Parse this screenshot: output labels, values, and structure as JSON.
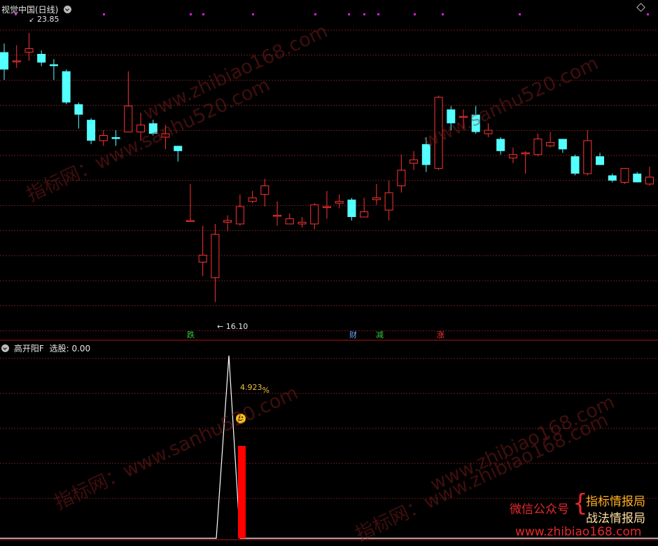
{
  "top_panel": {
    "title": "视觉中国(日线)",
    "high_label": "23.85",
    "low_label": "16.10",
    "arrow": "←"
  },
  "badges": [
    {
      "text": "跌",
      "color": "#33cc33"
    },
    {
      "text": "财",
      "color": "#66aaff"
    },
    {
      "text": "减",
      "color": "#33cc33"
    },
    {
      "text": "涨",
      "color": "#ff3333"
    }
  ],
  "bottom_panel": {
    "title": "高开阳F",
    "select_label": "选股:",
    "select_value": "0.00",
    "percent_value": "4.923",
    "percent_sign": "%"
  },
  "watermarks": [
    "指标网：www.sanhu520.com",
    "www.zhibiao168.com",
    "www.sanhu520.com",
    "www.zhibiao168.com",
    "指标网：www.sanhu520.com",
    "指标网：www.zhibiao168.com"
  ],
  "brand": {
    "wechat": "微信公众号",
    "line1": "指标情报局",
    "line2": "战法情报局",
    "url": "www.zhibiao168.com"
  },
  "colors": {
    "up": "#ff3232",
    "down": "#54ffff",
    "grid": "#6e1a1a",
    "separator": "#b01515"
  },
  "chart_data": {
    "type": "candlestick",
    "price_range": [
      15.0,
      24.4
    ],
    "candles": [
      [
        23.3,
        22.8,
        23.55,
        22.5
      ],
      [
        23.05,
        23.05,
        23.5,
        22.85
      ],
      [
        23.3,
        23.4,
        23.85,
        23.05
      ],
      [
        23.25,
        23.0,
        23.35,
        22.9
      ],
      [
        22.95,
        22.9,
        23.1,
        22.5
      ],
      [
        22.75,
        21.85,
        22.8,
        21.8
      ],
      [
        21.8,
        21.5,
        21.85,
        21.1
      ],
      [
        21.35,
        20.75,
        21.4,
        20.65
      ],
      [
        20.75,
        20.9,
        21.05,
        20.6
      ],
      [
        20.85,
        20.8,
        21.05,
        20.6
      ],
      [
        21.0,
        21.75,
        22.75,
        21.05
      ],
      [
        21.0,
        21.2,
        21.55,
        20.75
      ],
      [
        21.25,
        20.95,
        21.35,
        20.9
      ],
      [
        20.85,
        20.95,
        21.2,
        20.5
      ],
      [
        20.6,
        20.45,
        20.6,
        20.15
      ],
      [
        18.45,
        18.45,
        19.5,
        18.45
      ],
      [
        17.25,
        17.45,
        18.3,
        16.85
      ],
      [
        16.8,
        18.05,
        18.35,
        16.1
      ],
      [
        18.4,
        18.45,
        18.6,
        18.15
      ],
      [
        18.35,
        18.85,
        19.2,
        18.3
      ],
      [
        19.0,
        19.1,
        19.3,
        18.95
      ],
      [
        19.2,
        19.45,
        19.65,
        18.85
      ],
      [
        18.6,
        18.6,
        19.0,
        18.3
      ],
      [
        18.35,
        18.5,
        18.65,
        18.35
      ],
      [
        18.35,
        18.4,
        18.55,
        18.25
      ],
      [
        18.35,
        18.9,
        18.95,
        18.2
      ],
      [
        18.85,
        18.85,
        19.3,
        18.5
      ],
      [
        18.95,
        19.0,
        19.2,
        18.8
      ],
      [
        19.05,
        18.55,
        19.1,
        18.45
      ],
      [
        18.55,
        18.7,
        19.1,
        18.55
      ],
      [
        19.05,
        19.1,
        19.5,
        18.9
      ],
      [
        18.75,
        19.25,
        19.6,
        18.45
      ],
      [
        19.45,
        19.9,
        20.35,
        19.25
      ],
      [
        20.1,
        20.2,
        20.45,
        19.9
      ],
      [
        20.65,
        20.05,
        20.85,
        19.85
      ],
      [
        19.95,
        22.0,
        22.05,
        19.9
      ],
      [
        21.65,
        21.25,
        21.75,
        21.05
      ],
      [
        21.45,
        21.45,
        21.65,
        21.1
      ],
      [
        21.5,
        21.0,
        21.75,
        20.95
      ],
      [
        20.95,
        21.05,
        21.25,
        20.85
      ],
      [
        20.8,
        20.45,
        20.85,
        20.35
      ],
      [
        20.25,
        20.35,
        20.55,
        20.1
      ],
      [
        20.4,
        20.4,
        20.45,
        19.8
      ],
      [
        20.35,
        20.8,
        20.95,
        20.3
      ],
      [
        20.6,
        20.7,
        21.0,
        20.55
      ],
      [
        20.8,
        20.5,
        20.8,
        20.4
      ],
      [
        20.3,
        19.8,
        20.35,
        19.75
      ],
      [
        19.8,
        20.75,
        21.05,
        19.75
      ],
      [
        20.3,
        20.05,
        20.4,
        20.05
      ],
      [
        19.75,
        19.6,
        19.8,
        19.55
      ],
      [
        19.55,
        19.95,
        19.95,
        19.5
      ],
      [
        19.8,
        19.55,
        19.85,
        19.55
      ],
      [
        19.5,
        19.7,
        20.0,
        19.45
      ]
    ]
  }
}
